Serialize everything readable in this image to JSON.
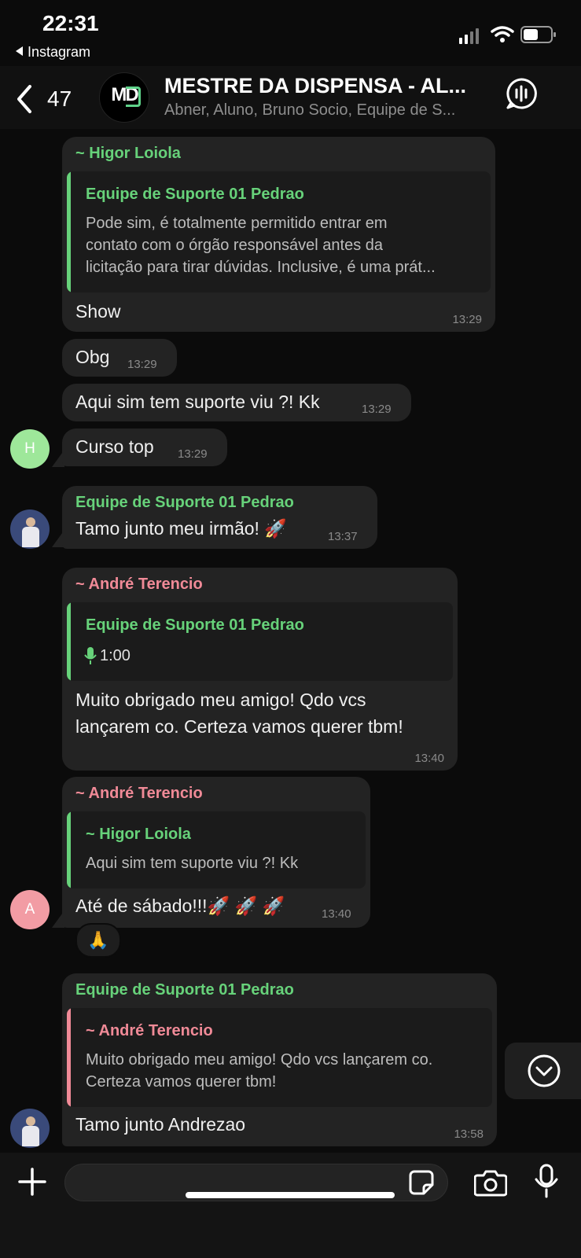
{
  "status_bar": {
    "time": "22:31",
    "back_app": "Instagram"
  },
  "header": {
    "back_count": "47",
    "group_logo": "MD",
    "title": "MESTRE DA DISPENSA - AL...",
    "subtitle": "Abner, Aluno, Bruno Socio, Equipe de S..."
  },
  "messages": [
    {
      "sender": "~ Higor Loiola",
      "quote_sender": "Equipe de Suporte 01 Pedrao",
      "quote_lines": [
        "Pode sim, é totalmente permitido entrar em",
        "contato com o órgão responsável antes da",
        "licitação para tirar dúvidas. Inclusive, é uma prát..."
      ],
      "text": "Show",
      "time": "13:29"
    },
    {
      "text": "Obg",
      "time": "13:29"
    },
    {
      "text": "Aqui sim tem suporte viu ?! Kk",
      "time": "13:29"
    },
    {
      "avatar": "H",
      "text": "Curso top",
      "time": "13:29"
    },
    {
      "sender": "Equipe de Suporte 01 Pedrao",
      "text": "Tamo junto meu irmão! 🚀",
      "time": "13:37"
    },
    {
      "sender": "~ André Terencio",
      "quote_sender": "Equipe de Suporte 01 Pedrao",
      "quote_audio": "1:00",
      "text_lines": [
        "Muito obrigado meu amigo! Qdo vcs",
        "lançarem co. Certeza vamos querer tbm!"
      ],
      "time": "13:40"
    },
    {
      "sender": "~ André Terencio",
      "quote_sender": "~ Higor Loiola",
      "quote_lines": [
        "Aqui sim tem suporte viu ?! Kk"
      ],
      "avatar": "A",
      "text": "Até de sábado!!!🚀 🚀 🚀",
      "time": "13:40",
      "reaction": "🙏"
    },
    {
      "sender": "Equipe de Suporte 01 Pedrao",
      "quote_sender": "~ André Terencio",
      "quote_lines": [
        "Muito obrigado meu amigo! Qdo vcs lançarem co.",
        "Certeza vamos querer tbm!"
      ],
      "text": "Tamo junto Andrezao",
      "time": "13:58"
    }
  ],
  "colors": {
    "green_name": "#67d27a",
    "pink_name": "#f08a97",
    "bubble": "#232323",
    "background": "#0b0b0b"
  },
  "icons": [
    "chevron-left-icon",
    "voice-call-icon",
    "plus-icon",
    "sticker-icon",
    "camera-icon",
    "microphone-icon",
    "chevron-down-circle-icon",
    "wifi-icon",
    "battery-icon",
    "signal-icon"
  ]
}
